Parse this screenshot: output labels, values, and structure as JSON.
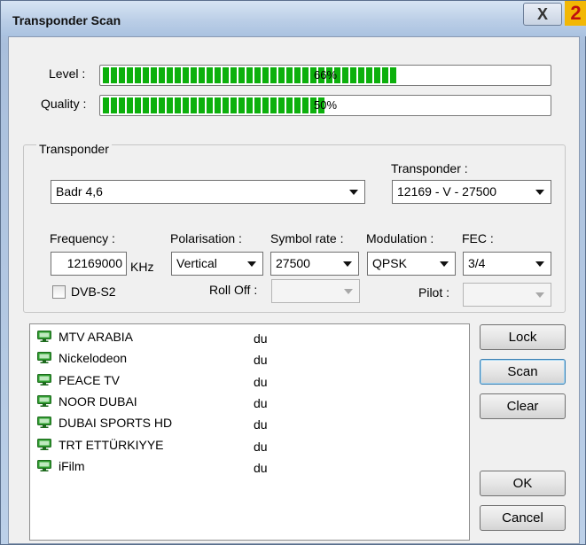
{
  "window": {
    "title": "Transponder Scan",
    "close_label": "X",
    "badge": "2"
  },
  "signal": {
    "level_label": "Level :",
    "level_value": 66,
    "level_text": "66%",
    "quality_label": "Quality :",
    "quality_value": 50,
    "quality_text": "50%"
  },
  "transponder": {
    "group_label": "Transponder",
    "satellite_value": "Badr 4,6",
    "transponder_label": "Transponder :",
    "transponder_value": "12169 - V - 27500",
    "frequency_label": "Frequency :",
    "frequency_value": "12169000",
    "frequency_unit": "KHz",
    "polarisation_label": "Polarisation :",
    "polarisation_value": "Vertical",
    "symbol_rate_label": "Symbol rate :",
    "symbol_rate_value": "27500",
    "modulation_label": "Modulation :",
    "modulation_value": "QPSK",
    "fec_label": "FEC :",
    "fec_value": "3/4",
    "dvbs2_label": "DVB-S2",
    "dvbs2_checked": false,
    "rolloff_label": "Roll Off :",
    "rolloff_value": "",
    "pilot_label": "Pilot :",
    "pilot_value": ""
  },
  "channels": [
    {
      "name": "MTV ARABIA",
      "provider": "du"
    },
    {
      "name": "Nickelodeon",
      "provider": "du"
    },
    {
      "name": "PEACE TV",
      "provider": "du"
    },
    {
      "name": "NOOR DUBAI",
      "provider": "du"
    },
    {
      "name": "DUBAI SPORTS HD",
      "provider": "du"
    },
    {
      "name": "TRT ETTÜRKIYYE",
      "provider": "du"
    },
    {
      "name": "iFilm",
      "provider": "du"
    }
  ],
  "buttons": {
    "lock": "Lock",
    "scan": "Scan",
    "clear": "Clear",
    "ok": "OK",
    "cancel": "Cancel"
  },
  "colors": {
    "meter_green": "#0cb00c",
    "tv_icon_green": "#2e9d2e"
  }
}
